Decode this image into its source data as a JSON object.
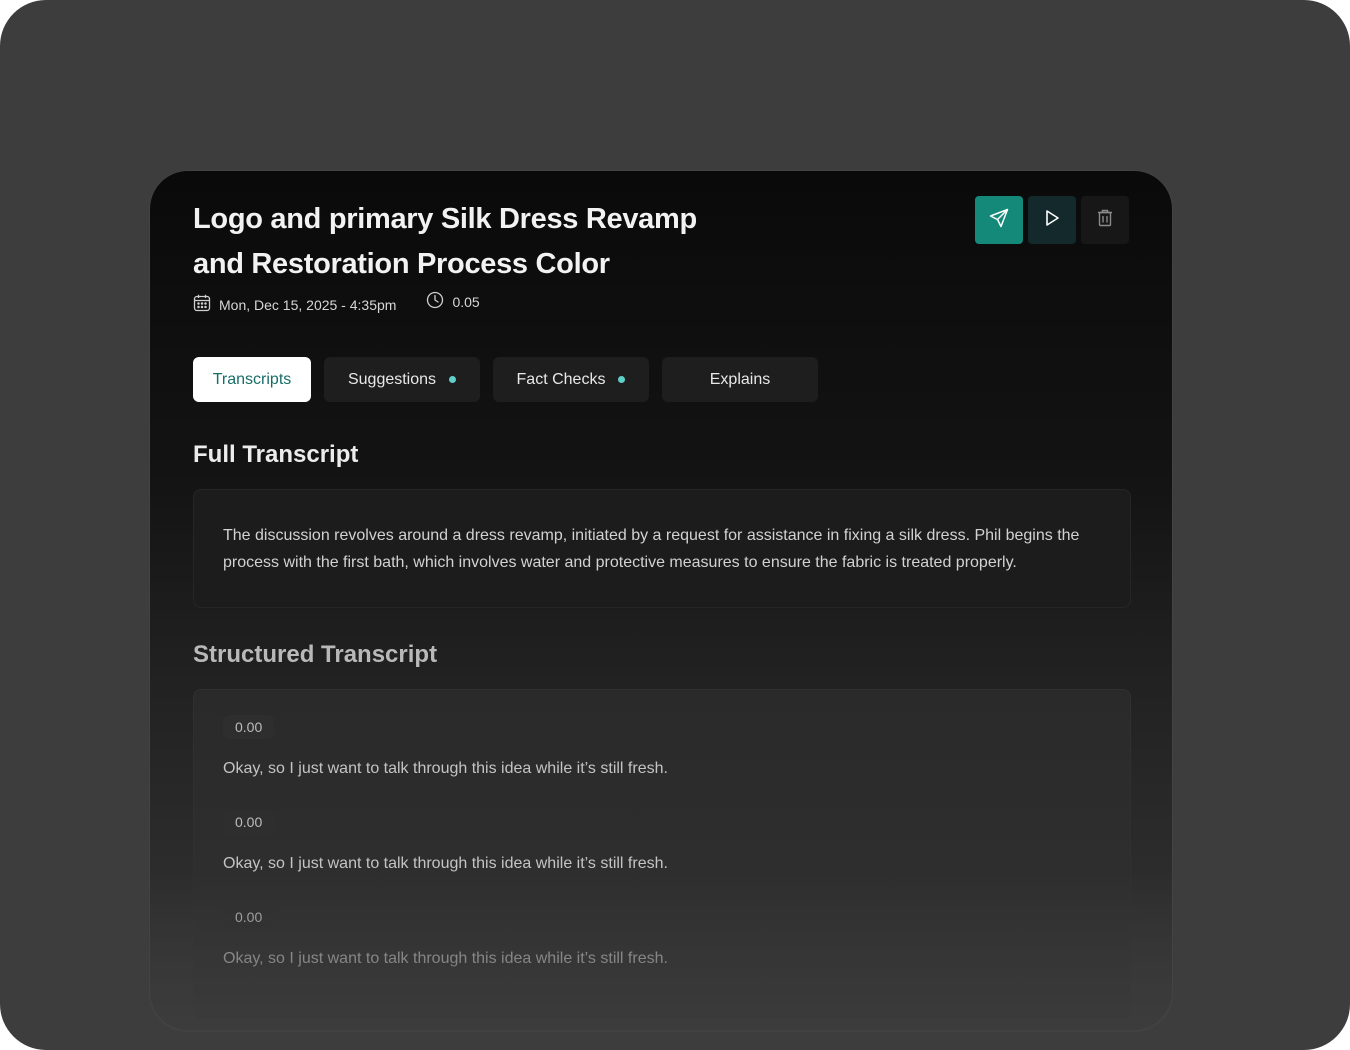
{
  "header": {
    "title": "Logo and primary Silk Dress Revamp and Restoration Process Color",
    "date": "Mon, Dec 15, 2025  - 4:35pm",
    "duration": "0.05",
    "icons": [
      "calendar-icon",
      "clock-icon"
    ]
  },
  "actions": {
    "send": "send-icon",
    "play": "play-icon",
    "delete": "trash-icon"
  },
  "tabs": [
    {
      "label": "Transcripts",
      "active": true,
      "dot": false
    },
    {
      "label": "Suggestions",
      "active": false,
      "dot": true
    },
    {
      "label": "Fact Checks",
      "active": false,
      "dot": true
    },
    {
      "label": "Explains",
      "active": false,
      "dot": false
    }
  ],
  "full_transcript": {
    "title": "Full Transcript",
    "text": "The discussion revolves around a dress revamp, initiated by a request for assistance in fixing a silk dress. Phil begins the process with the first bath, which involves water and protective measures to ensure the fabric is treated properly."
  },
  "structured_transcript": {
    "title": "Structured Transcript",
    "entries": [
      {
        "time": "0.00",
        "text": "Okay, so I just want to talk through this idea while it’s still fresh."
      },
      {
        "time": "0.00",
        "text": "Okay, so I just want to talk through this idea while it’s still fresh."
      },
      {
        "time": "0.00",
        "text": "Okay, so I just want to talk through this idea while it’s still fresh."
      }
    ]
  },
  "colors": {
    "accent": "#14897a",
    "dot": "#5fd0c9",
    "active_tab_text": "#176e66"
  }
}
